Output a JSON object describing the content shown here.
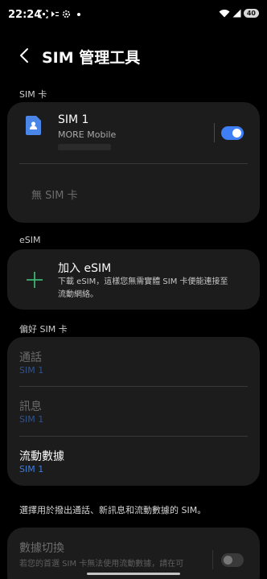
{
  "status_bar": {
    "time": "22:24",
    "left_icons": [
      "screenshot-icon",
      "vpn-icon",
      "settings-icon",
      "notification-dot-icon"
    ],
    "right_icons": [
      "wifi-icon",
      "signal-icon"
    ],
    "battery": "40"
  },
  "app_bar": {
    "back_icon": "chevron-left-icon",
    "title": "SIM 管理工具"
  },
  "sim_section": {
    "header": "SIM 卡",
    "sim1": {
      "icon": "sim-card-icon",
      "title": "SIM 1",
      "carrier": "MORE Mobile",
      "enabled": true
    },
    "no_sim": "無 SIM 卡"
  },
  "esim_section": {
    "header": "eSIM",
    "add": {
      "icon": "plus-icon",
      "title": "加入 eSIM",
      "description_line1": "下載 eSIM，這樣您無需實體 SIM 卡便能連接至",
      "description_line2": "流動網絡。"
    }
  },
  "preferred_section": {
    "header": "偏好 SIM 卡",
    "calls": {
      "title": "通話",
      "value": "SIM 1"
    },
    "messages": {
      "title": "訊息",
      "value": "SIM 1"
    },
    "mobile_data": {
      "title": "流動數據",
      "value": "SIM 1"
    }
  },
  "footer_text": "選擇用於撥出通話、新訊息和流動數據的 SIM。",
  "data_switch": {
    "title": "數據切換",
    "description": "若您的首選 SIM 卡無法使用流動數據，請在可",
    "enabled": false
  },
  "colors": {
    "background": "#000000",
    "card": "#1c1c1c",
    "accent_blue": "#3e7ff5",
    "plus_green": "#3cb371"
  }
}
